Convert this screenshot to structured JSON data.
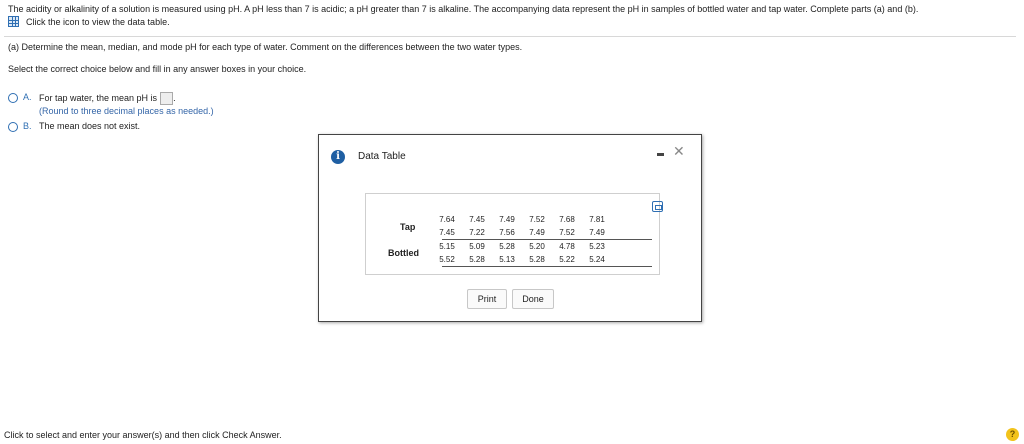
{
  "problem_text": "The acidity or alkalinity of a solution is measured using pH. A pH less than 7 is acidic; a pH greater than 7 is alkaline. The accompanying data represent the pH in samples of bottled water and tap water. Complete parts (a) and (b).",
  "data_link_text": "Click the icon to view the data table.",
  "part_a": "(a) Determine the mean, median, and mode pH for each type of water. Comment on the differences between the two water types.",
  "instructions": "Select the correct choice below and fill in any answer boxes in your choice.",
  "choices": [
    {
      "letter": "A.",
      "text": "For tap water, the mean pH is",
      "hint": "(Round to three decimal places as needed.)"
    },
    {
      "letter": "B.",
      "text": "The mean does not exist."
    }
  ],
  "modal": {
    "title": "Data Table",
    "close_symbol": "✕",
    "table": {
      "groups": [
        {
          "label": "Tap",
          "rows": [
            [
              "7.64",
              "7.45",
              "7.49",
              "7.52",
              "7.68",
              "7.81"
            ],
            [
              "7.45",
              "7.22",
              "7.56",
              "7.49",
              "7.52",
              "7.49"
            ]
          ]
        },
        {
          "label": "Bottled",
          "rows": [
            [
              "5.15",
              "5.09",
              "5.28",
              "5.20",
              "4.78",
              "5.23"
            ],
            [
              "5.52",
              "5.28",
              "5.13",
              "5.28",
              "5.22",
              "5.24"
            ]
          ]
        }
      ]
    },
    "print_label": "Print",
    "done_label": "Done"
  },
  "footer_text": "Click to select and enter your answer(s) and then click Check Answer.",
  "help_symbol": "?",
  "colors": {
    "accent": "#2f6fb3",
    "help": "#f2c31b",
    "info": "#1f5fa3"
  }
}
